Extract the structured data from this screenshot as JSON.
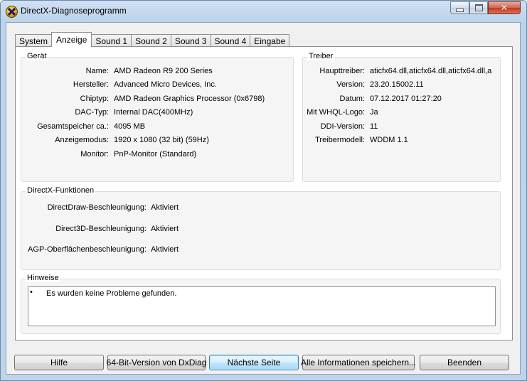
{
  "window": {
    "title": "DirectX-Diagnoseprogramm"
  },
  "icons": {
    "app": "directx-icon",
    "minimize": "minimize-icon",
    "maximize": "maximize-icon",
    "close": "close-icon"
  },
  "tabs": [
    {
      "label": "System",
      "active": false
    },
    {
      "label": "Anzeige",
      "active": true
    },
    {
      "label": "Sound 1",
      "active": false
    },
    {
      "label": "Sound 2",
      "active": false
    },
    {
      "label": "Sound 3",
      "active": false
    },
    {
      "label": "Sound 4",
      "active": false
    },
    {
      "label": "Eingabe",
      "active": false
    }
  ],
  "device": {
    "title": "Gerät",
    "rows": [
      {
        "label": "Name:",
        "value": "AMD Radeon R9 200 Series"
      },
      {
        "label": "Hersteller:",
        "value": "Advanced Micro Devices, Inc."
      },
      {
        "label": "Chiptyp:",
        "value": "AMD Radeon Graphics Processor (0x6798)"
      },
      {
        "label": "DAC-Typ:",
        "value": "Internal DAC(400MHz)"
      },
      {
        "label": "Gesamtspeicher ca.:",
        "value": "4095 MB"
      },
      {
        "label": "Anzeigemodus:",
        "value": "1920 x 1080 (32 bit) (59Hz)"
      },
      {
        "label": "Monitor:",
        "value": "PnP-Monitor (Standard)"
      }
    ]
  },
  "driver": {
    "title": "Treiber",
    "rows": [
      {
        "label": "Haupttreiber:",
        "value": "aticfx64.dll,aticfx64.dll,aticfx64.dll,a"
      },
      {
        "label": "Version:",
        "value": "23.20.15002.11"
      },
      {
        "label": "Datum:",
        "value": "07.12.2017 01:27:20"
      },
      {
        "label": "Mit WHQL-Logo:",
        "value": "Ja"
      },
      {
        "label": "DDI-Version:",
        "value": "11"
      },
      {
        "label": "Treibermodell:",
        "value": "WDDM 1.1"
      }
    ]
  },
  "features": {
    "title": "DirectX-Funktionen",
    "rows": [
      {
        "label": "DirectDraw-Beschleunigung:",
        "value": "Aktiviert"
      },
      {
        "label": "Direct3D-Beschleunigung:",
        "value": "Aktiviert"
      },
      {
        "label": "AGP-Oberflächenbeschleunigung:",
        "value": "Aktiviert"
      }
    ]
  },
  "notes": {
    "title": "Hinweise",
    "bullet": "•",
    "items": [
      "Es wurden keine Probleme gefunden."
    ]
  },
  "buttons": {
    "help": "Hilfe",
    "dxdiag64": "64-Bit-Version von DxDiag",
    "next": "Nächste Seite",
    "save_all": "Alle Informationen speichern...",
    "exit": "Beenden"
  }
}
